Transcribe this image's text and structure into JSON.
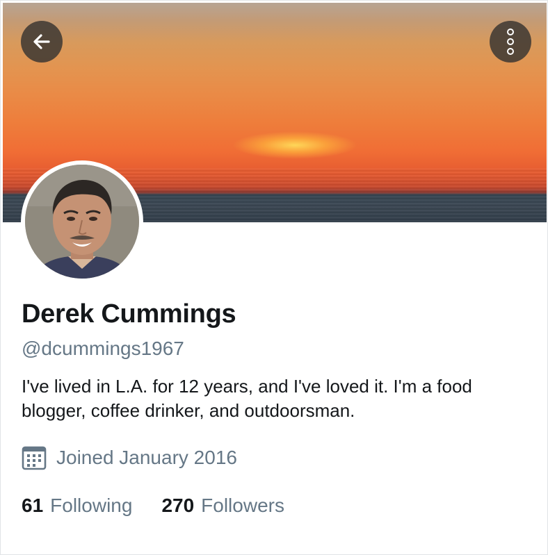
{
  "profile": {
    "name": "Derek Cummings",
    "handle": "@dcummings1967",
    "bio": "I've lived in L.A. for 12 years, and I've loved it. I'm a food blogger, coffee drinker, and outdoorsman.",
    "joined": "Joined January 2016"
  },
  "stats": {
    "following_count": "61",
    "following_label": "Following",
    "followers_count": "270",
    "followers_label": "Followers"
  },
  "icons": {
    "back": "arrow-left-icon",
    "more": "more-vertical-icon",
    "calendar": "calendar-icon"
  },
  "colors": {
    "secondary_text": "#657786",
    "primary_text": "#14171a",
    "overlay_button": "#3c3732"
  }
}
